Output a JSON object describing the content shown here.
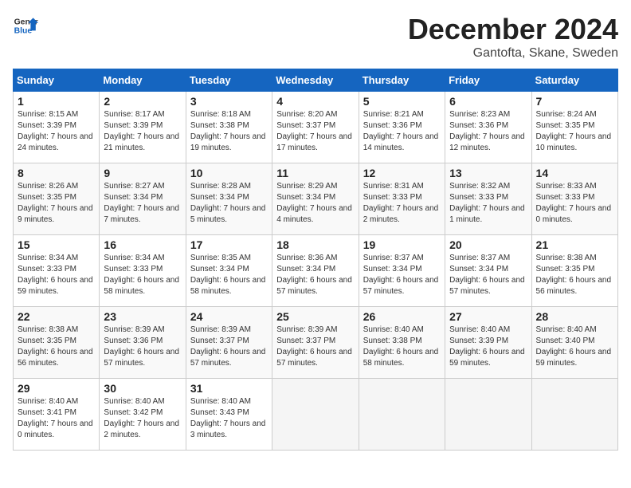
{
  "logo": {
    "general": "General",
    "blue": "Blue"
  },
  "title": "December 2024",
  "location": "Gantofta, Skane, Sweden",
  "days_of_week": [
    "Sunday",
    "Monday",
    "Tuesday",
    "Wednesday",
    "Thursday",
    "Friday",
    "Saturday"
  ],
  "weeks": [
    [
      {
        "day": "1",
        "sunrise": "8:15 AM",
        "sunset": "3:39 PM",
        "daylight": "7 hours and 24 minutes."
      },
      {
        "day": "2",
        "sunrise": "8:17 AM",
        "sunset": "3:39 PM",
        "daylight": "7 hours and 21 minutes."
      },
      {
        "day": "3",
        "sunrise": "8:18 AM",
        "sunset": "3:38 PM",
        "daylight": "7 hours and 19 minutes."
      },
      {
        "day": "4",
        "sunrise": "8:20 AM",
        "sunset": "3:37 PM",
        "daylight": "7 hours and 17 minutes."
      },
      {
        "day": "5",
        "sunrise": "8:21 AM",
        "sunset": "3:36 PM",
        "daylight": "7 hours and 14 minutes."
      },
      {
        "day": "6",
        "sunrise": "8:23 AM",
        "sunset": "3:36 PM",
        "daylight": "7 hours and 12 minutes."
      },
      {
        "day": "7",
        "sunrise": "8:24 AM",
        "sunset": "3:35 PM",
        "daylight": "7 hours and 10 minutes."
      }
    ],
    [
      {
        "day": "8",
        "sunrise": "8:26 AM",
        "sunset": "3:35 PM",
        "daylight": "7 hours and 9 minutes."
      },
      {
        "day": "9",
        "sunrise": "8:27 AM",
        "sunset": "3:34 PM",
        "daylight": "7 hours and 7 minutes."
      },
      {
        "day": "10",
        "sunrise": "8:28 AM",
        "sunset": "3:34 PM",
        "daylight": "7 hours and 5 minutes."
      },
      {
        "day": "11",
        "sunrise": "8:29 AM",
        "sunset": "3:34 PM",
        "daylight": "7 hours and 4 minutes."
      },
      {
        "day": "12",
        "sunrise": "8:31 AM",
        "sunset": "3:33 PM",
        "daylight": "7 hours and 2 minutes."
      },
      {
        "day": "13",
        "sunrise": "8:32 AM",
        "sunset": "3:33 PM",
        "daylight": "7 hours and 1 minute."
      },
      {
        "day": "14",
        "sunrise": "8:33 AM",
        "sunset": "3:33 PM",
        "daylight": "7 hours and 0 minutes."
      }
    ],
    [
      {
        "day": "15",
        "sunrise": "8:34 AM",
        "sunset": "3:33 PM",
        "daylight": "6 hours and 59 minutes."
      },
      {
        "day": "16",
        "sunrise": "8:34 AM",
        "sunset": "3:33 PM",
        "daylight": "6 hours and 58 minutes."
      },
      {
        "day": "17",
        "sunrise": "8:35 AM",
        "sunset": "3:34 PM",
        "daylight": "6 hours and 58 minutes."
      },
      {
        "day": "18",
        "sunrise": "8:36 AM",
        "sunset": "3:34 PM",
        "daylight": "6 hours and 57 minutes."
      },
      {
        "day": "19",
        "sunrise": "8:37 AM",
        "sunset": "3:34 PM",
        "daylight": "6 hours and 57 minutes."
      },
      {
        "day": "20",
        "sunrise": "8:37 AM",
        "sunset": "3:34 PM",
        "daylight": "6 hours and 57 minutes."
      },
      {
        "day": "21",
        "sunrise": "8:38 AM",
        "sunset": "3:35 PM",
        "daylight": "6 hours and 56 minutes."
      }
    ],
    [
      {
        "day": "22",
        "sunrise": "8:38 AM",
        "sunset": "3:35 PM",
        "daylight": "6 hours and 56 minutes."
      },
      {
        "day": "23",
        "sunrise": "8:39 AM",
        "sunset": "3:36 PM",
        "daylight": "6 hours and 57 minutes."
      },
      {
        "day": "24",
        "sunrise": "8:39 AM",
        "sunset": "3:37 PM",
        "daylight": "6 hours and 57 minutes."
      },
      {
        "day": "25",
        "sunrise": "8:39 AM",
        "sunset": "3:37 PM",
        "daylight": "6 hours and 57 minutes."
      },
      {
        "day": "26",
        "sunrise": "8:40 AM",
        "sunset": "3:38 PM",
        "daylight": "6 hours and 58 minutes."
      },
      {
        "day": "27",
        "sunrise": "8:40 AM",
        "sunset": "3:39 PM",
        "daylight": "6 hours and 59 minutes."
      },
      {
        "day": "28",
        "sunrise": "8:40 AM",
        "sunset": "3:40 PM",
        "daylight": "6 hours and 59 minutes."
      }
    ],
    [
      {
        "day": "29",
        "sunrise": "8:40 AM",
        "sunset": "3:41 PM",
        "daylight": "7 hours and 0 minutes."
      },
      {
        "day": "30",
        "sunrise": "8:40 AM",
        "sunset": "3:42 PM",
        "daylight": "7 hours and 2 minutes."
      },
      {
        "day": "31",
        "sunrise": "8:40 AM",
        "sunset": "3:43 PM",
        "daylight": "7 hours and 3 minutes."
      },
      null,
      null,
      null,
      null
    ]
  ]
}
